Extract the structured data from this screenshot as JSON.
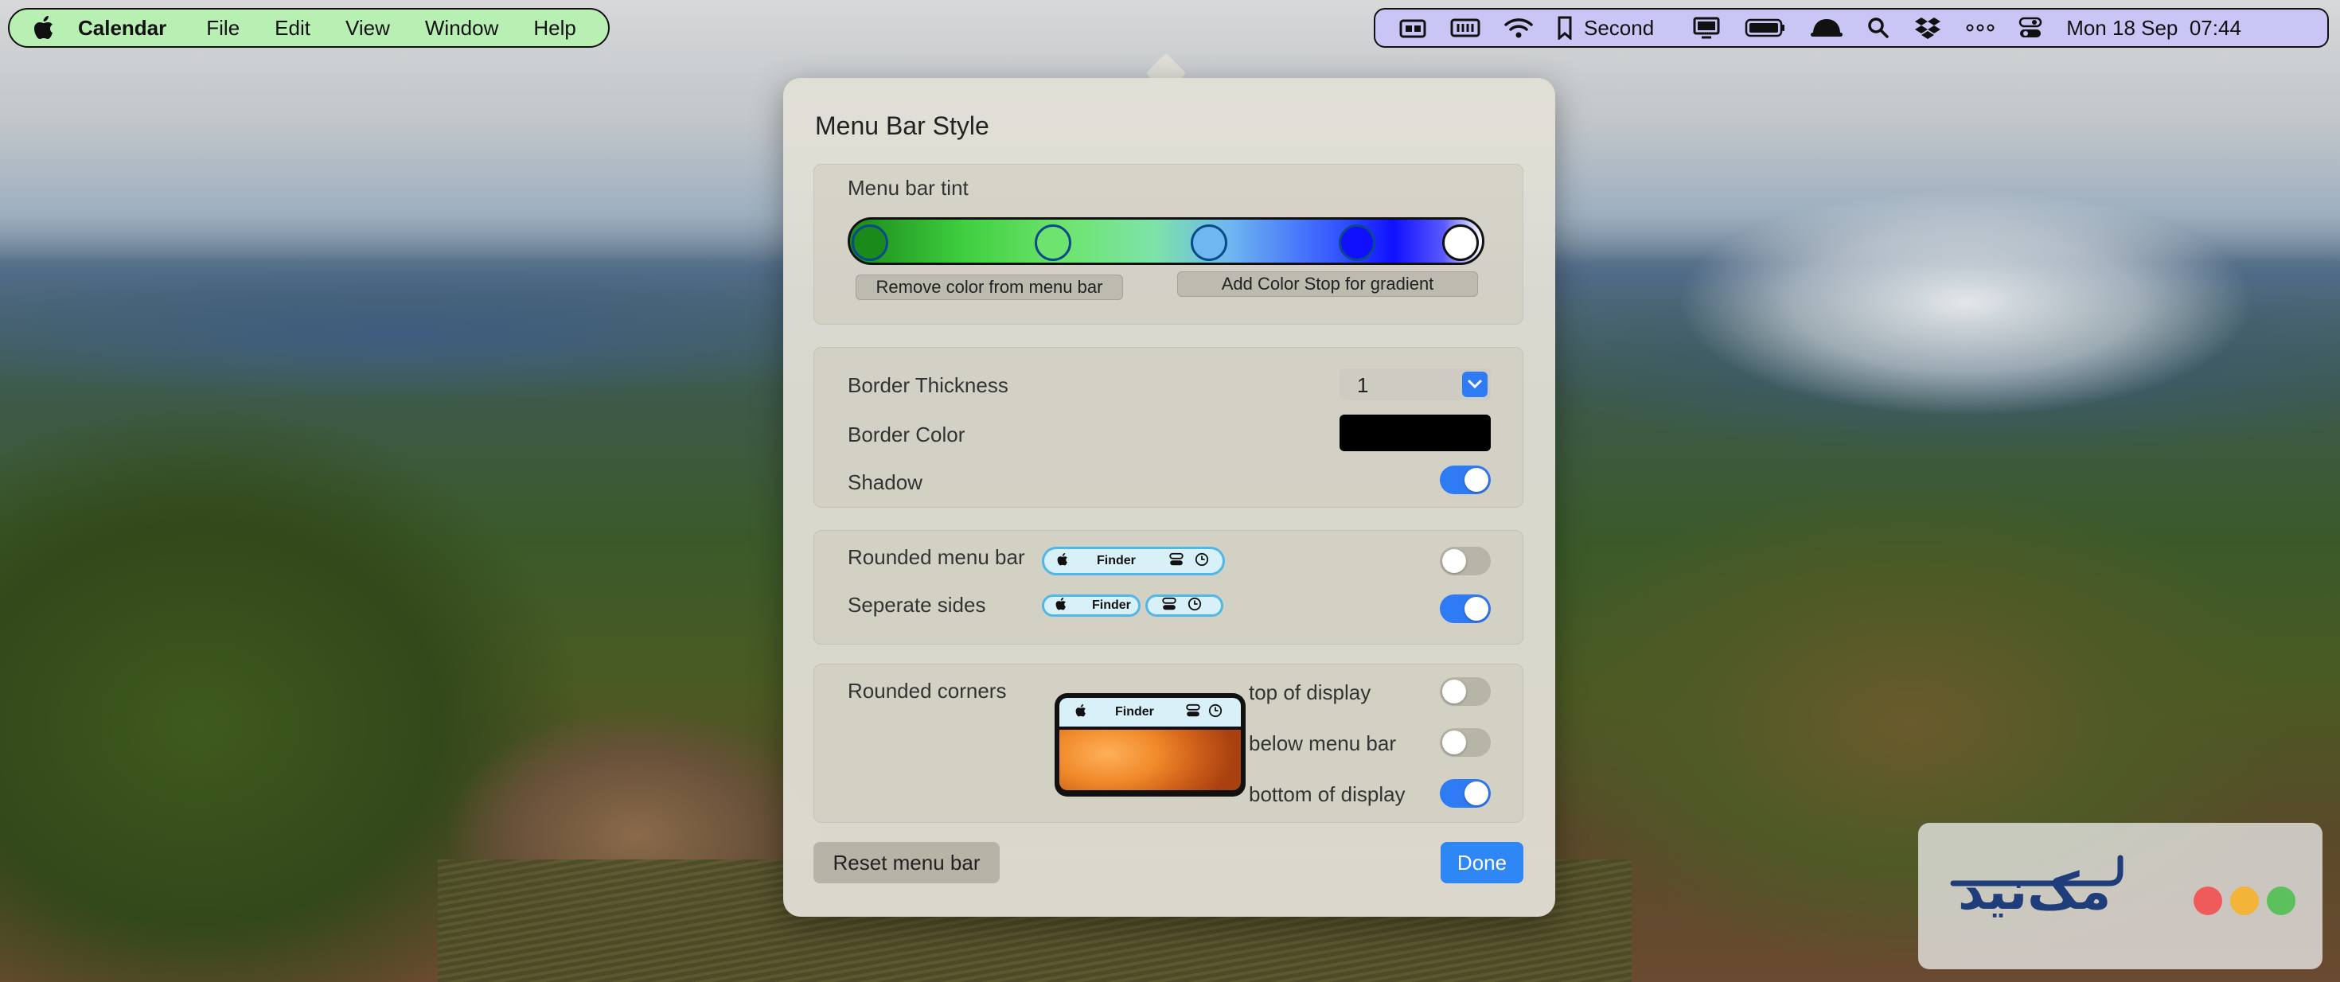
{
  "menubar_left": {
    "app_name": "Calendar",
    "items": [
      "File",
      "Edit",
      "View",
      "Window",
      "Help"
    ]
  },
  "menubar_right": {
    "bookmark_label": "Second",
    "datetime": "Mon 18 Sep  07:44"
  },
  "popover": {
    "title": "Menu Bar Style",
    "tint": {
      "label": "Menu bar tint",
      "stop_colors": [
        "#1a8a1a",
        "#6ee46e",
        "#6fb7f0",
        "#1010ff",
        "#ffffff"
      ],
      "remove_label": "Remove color from menu bar",
      "add_stop_label": "Add Color Stop for gradient"
    },
    "border": {
      "thickness_label": "Border Thickness",
      "thickness_value": "1",
      "color_label": "Border Color",
      "color_value": "#000000",
      "shadow_label": "Shadow",
      "shadow_on": true
    },
    "rounded": {
      "rounded_label": "Rounded menu bar",
      "rounded_on": false,
      "separate_label": "Seperate sides",
      "separate_on": true,
      "preview_app": "Finder"
    },
    "corners": {
      "label": "Rounded corners",
      "preview_app": "Finder",
      "top_label": "top of display",
      "top_on": false,
      "below_label": "below menu bar",
      "below_on": false,
      "bottom_label": "bottom of display",
      "bottom_on": true
    },
    "reset_label": "Reset menu bar",
    "done_label": "Done"
  },
  "watermark": {
    "text": "مک‌نید",
    "dot_colors": [
      "#ef5a5a",
      "#f2b53a",
      "#5cc05c"
    ]
  },
  "colors": {
    "left_bar_bg": "#b8f0b4",
    "right_bar_bg": "#c9c6f6",
    "accent": "#2f7bf5"
  }
}
